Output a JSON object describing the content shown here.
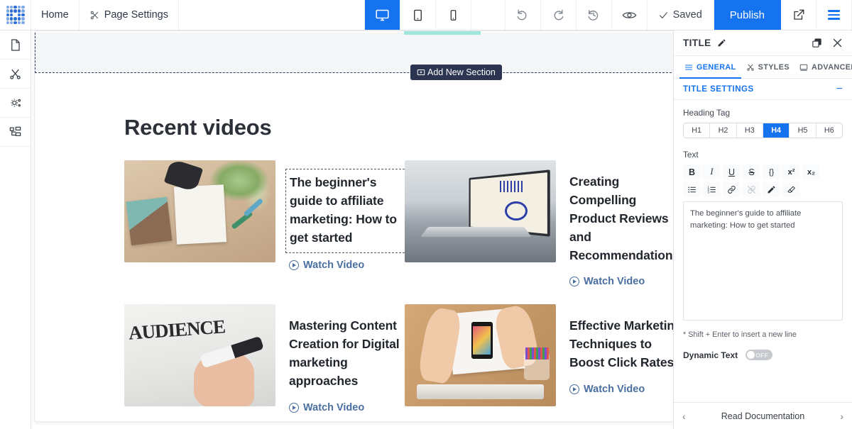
{
  "topbar": {
    "logo": "logo-icon",
    "home_label": "Home",
    "page_settings_label": "Page Settings",
    "devices": [
      {
        "name": "desktop",
        "label": "Desktop",
        "active": true
      },
      {
        "name": "tablet",
        "label": "Tablet",
        "active": false
      },
      {
        "name": "mobile",
        "label": "Mobile",
        "active": false
      }
    ],
    "undo_label": "Undo",
    "redo_label": "Redo",
    "history_label": "Revision History",
    "preview_label": "Preview",
    "saved_label": "Saved",
    "publish_label": "Publish",
    "open_external_label": "View Page",
    "menu_label": "Menu"
  },
  "rail": {
    "items": [
      {
        "name": "pages",
        "icon": "page-icon"
      },
      {
        "name": "elements",
        "icon": "scissors-icon"
      },
      {
        "name": "settings",
        "icon": "gears-icon"
      },
      {
        "name": "structure",
        "icon": "tree-icon"
      }
    ]
  },
  "canvas": {
    "add_section_label": "Add New Section",
    "section_title": "Recent videos",
    "watch_label": "Watch Video",
    "carousel_next": "›",
    "videos": [
      {
        "title": "The beginner's guide to affiliate marketing: How to get started",
        "thumb": "desk-with-marketing-books-plant-and-note",
        "selected": true
      },
      {
        "title": "Creating Compelling Product Reviews and Recommendations",
        "thumb": "laptop-with-analytics-dashboard",
        "selected": false
      },
      {
        "title": "Mastering Content Creation for Digital marketing approaches",
        "thumb": "hand-writing-audience-on-whiteboard",
        "selected": false
      },
      {
        "title": "Effective Marketing Techniques to Boost Click Rates",
        "thumb": "overhead-desk-with-phone-papers-and-markers",
        "selected": false
      }
    ]
  },
  "panel": {
    "title": "TITLE",
    "edit_icon": "pencil-icon",
    "duplicate_icon": "copy-icon",
    "close_icon": "close-icon",
    "tabs": [
      {
        "label": "GENERAL",
        "icon": "list-icon",
        "active": true
      },
      {
        "label": "STYLES",
        "icon": "scissors-icon",
        "active": false
      },
      {
        "label": "ADVANCED",
        "icon": "monitor-icon",
        "active": false
      }
    ],
    "section_label": "TITLE SETTINGS",
    "collapse_label": "−",
    "heading_tag_label": "Heading Tag",
    "heading_tags": [
      "H1",
      "H2",
      "H3",
      "H4",
      "H5",
      "H6"
    ],
    "heading_tag_active": "H4",
    "text_label": "Text",
    "rt_row1": [
      {
        "name": "bold",
        "glyph": "B"
      },
      {
        "name": "italic",
        "glyph": "I"
      },
      {
        "name": "underline",
        "glyph": "U"
      },
      {
        "name": "strikethrough",
        "glyph": "S"
      },
      {
        "name": "code",
        "glyph": "{}"
      },
      {
        "name": "superscript",
        "glyph": "x²"
      },
      {
        "name": "subscript",
        "glyph": "x₂"
      }
    ],
    "rt_row2": [
      {
        "name": "bullet-list",
        "glyph": "≔"
      },
      {
        "name": "numbered-list",
        "glyph": "≕"
      },
      {
        "name": "link",
        "glyph": "🔗"
      },
      {
        "name": "unlink",
        "glyph": "🔗"
      },
      {
        "name": "text-color",
        "glyph": "✎"
      },
      {
        "name": "clear-format",
        "glyph": "◣"
      }
    ],
    "textarea_value": "The beginner's guide to affiliate marketing: How to get started",
    "hint": "* Shift + Enter to insert a new line",
    "dynamic_text_label": "Dynamic Text",
    "dynamic_text_state": "OFF",
    "footer_label": "Read Documentation",
    "footer_prev": "‹",
    "footer_next": "›"
  },
  "colors": {
    "accent": "#1673f0",
    "dark_navy": "#2b3450",
    "teal": "#9fe6dd",
    "link": "#4a6fa0"
  }
}
